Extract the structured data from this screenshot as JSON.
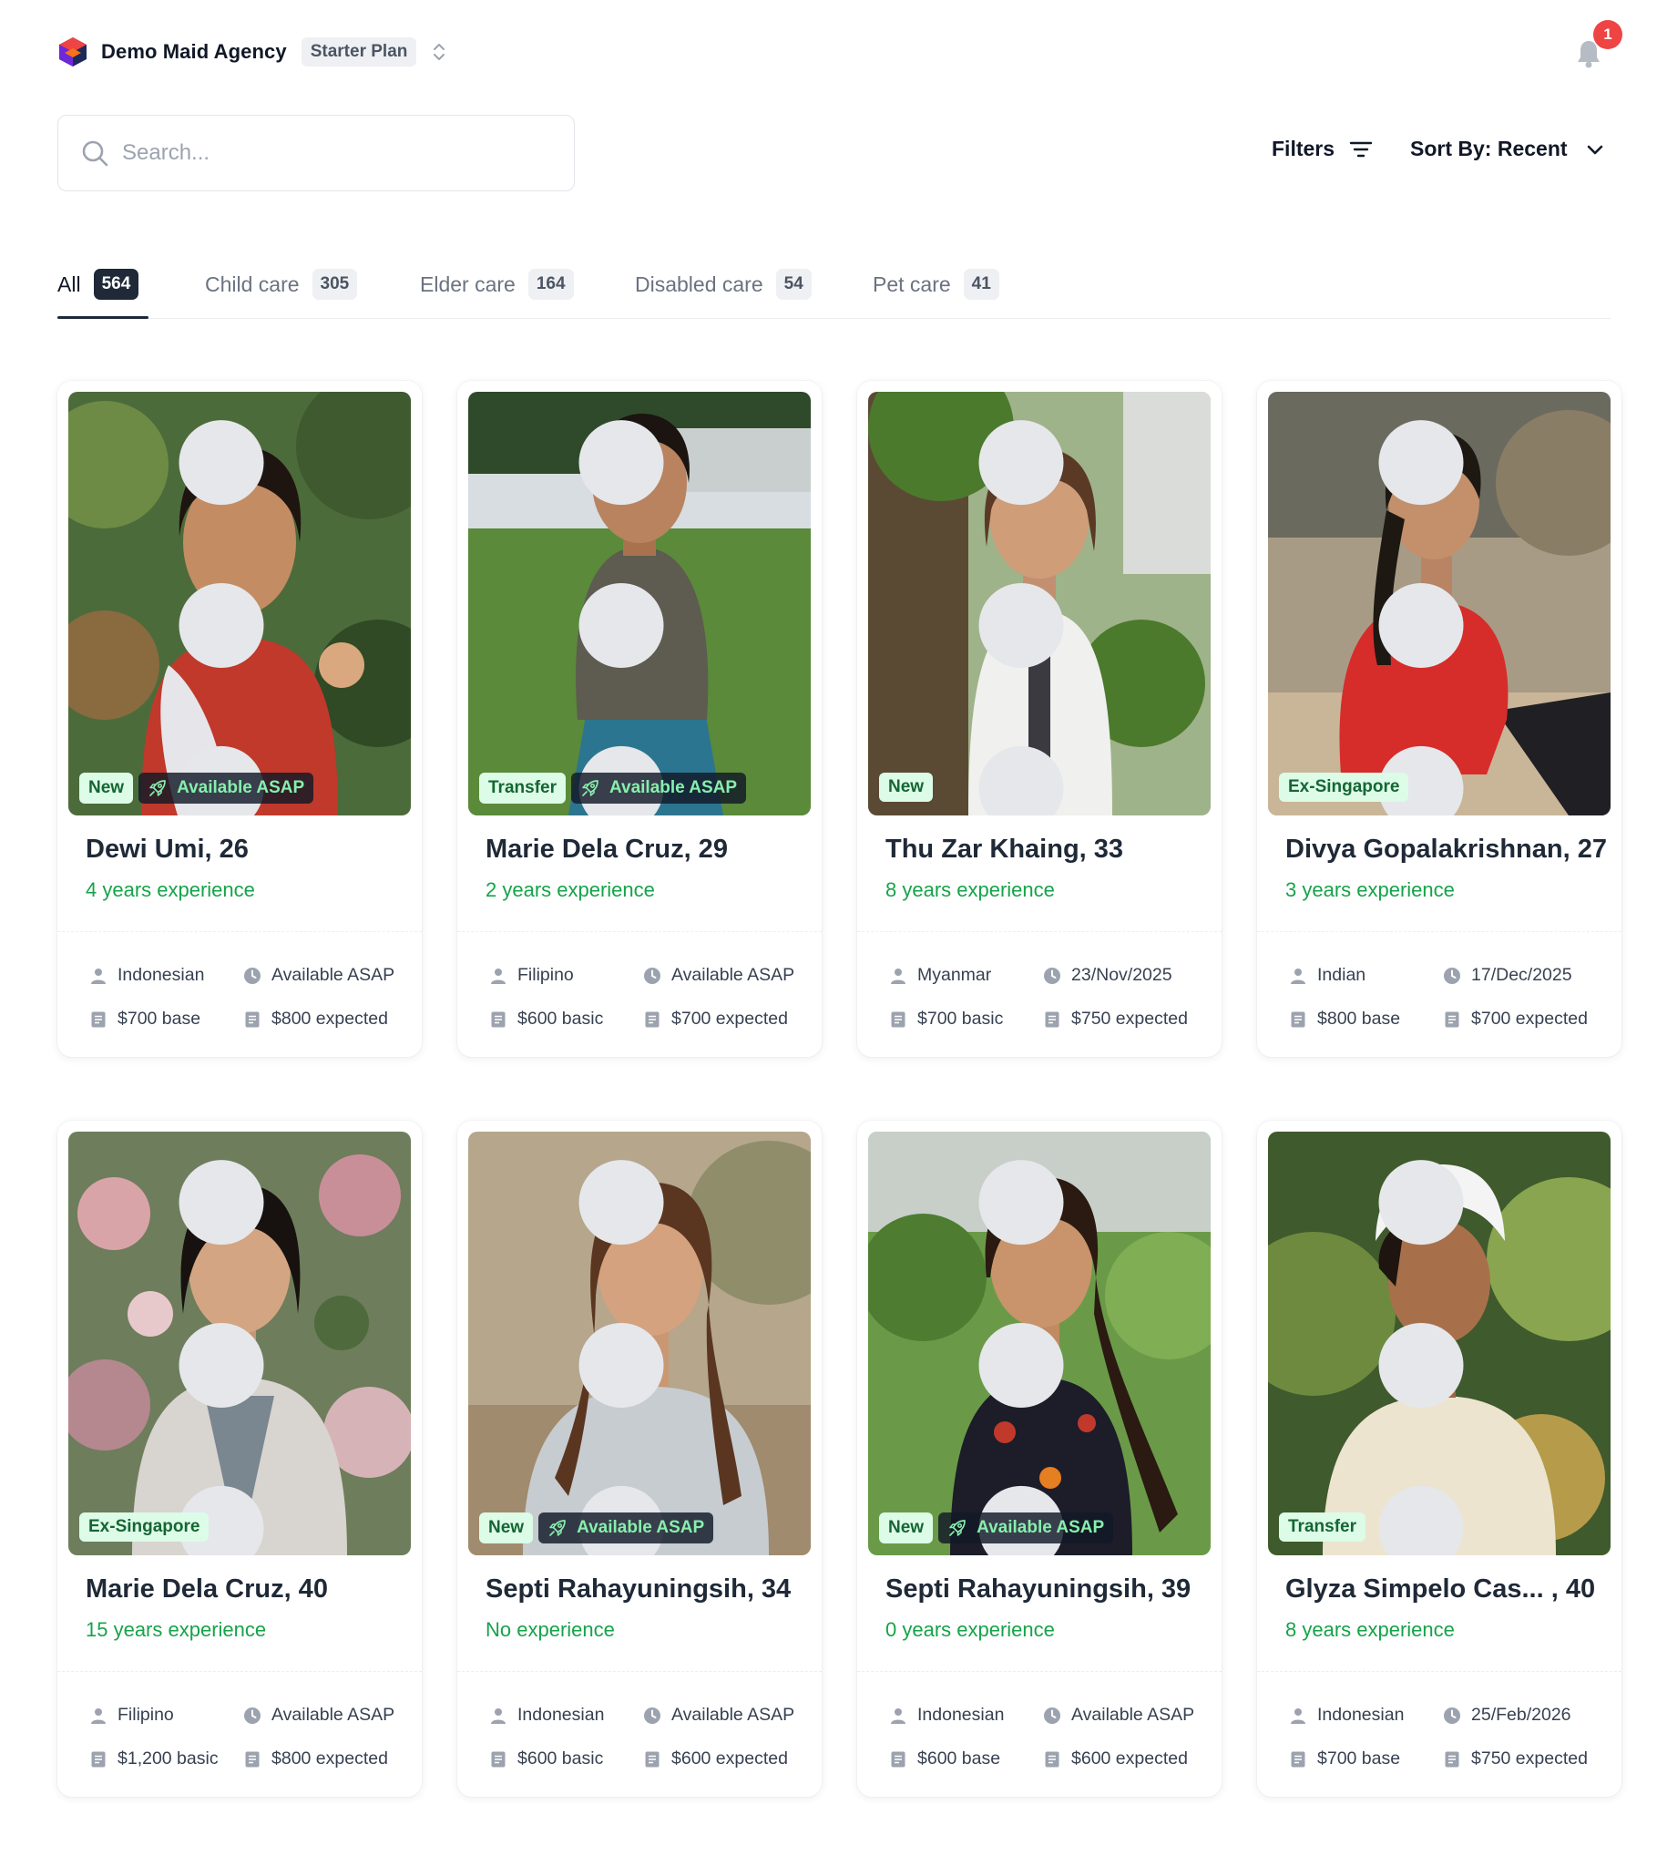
{
  "header": {
    "agency_name": "Demo Maid Agency",
    "plan_badge": "Starter Plan",
    "notification_count": "1"
  },
  "search": {
    "placeholder": "Search..."
  },
  "toolbar": {
    "filters_label": "Filters",
    "sort_label": "Sort By: Recent"
  },
  "tabs": [
    {
      "label": "All",
      "count": "564",
      "active": true
    },
    {
      "label": "Child care",
      "count": "305",
      "active": false
    },
    {
      "label": "Elder care",
      "count": "164",
      "active": false
    },
    {
      "label": "Disabled care",
      "count": "54",
      "active": false
    },
    {
      "label": "Pet care",
      "count": "41",
      "active": false
    }
  ],
  "icons": {
    "logo": "agency-logo-icon",
    "plan_switch": "chevron-up-down-icon",
    "notifications": "bell-icon",
    "search": "search-icon",
    "filters": "filter-lines-icon",
    "sort": "chevron-down-icon",
    "available_badge": "rocket-icon",
    "nationality": "person-icon",
    "availability": "clock-icon",
    "salary": "receipt-icon",
    "menu": "kebab-menu-icon"
  },
  "colors": {
    "accent_green": "#16a34a",
    "badge_light_bg": "#dcfce7",
    "badge_dark_text": "#86efac",
    "notification_red": "#ef4444",
    "primary_dark": "#1f2937"
  },
  "candidates": [
    {
      "name": "Dewi Umi, 26",
      "experience": "4 years experience",
      "badges": [
        "New"
      ],
      "available_badge": "Available ASAP",
      "nationality": "Indonesian",
      "availability": "Available ASAP",
      "salary": "$700 base",
      "expected": "$800 expected"
    },
    {
      "name": "Marie Dela Cruz, 29",
      "experience": "2 years experience",
      "badges": [
        "Transfer"
      ],
      "available_badge": "Available ASAP",
      "nationality": "Filipino",
      "availability": "Available ASAP",
      "salary": "$600 basic",
      "expected": "$700 expected"
    },
    {
      "name": "Thu Zar Khaing, 33",
      "experience": "8 years experience",
      "badges": [
        "New"
      ],
      "available_badge": "",
      "nationality": "Myanmar",
      "availability": "23/Nov/2025",
      "salary": "$700 basic",
      "expected": "$750 expected"
    },
    {
      "name": "Divya Gopalakrishnan, 27",
      "experience": "3 years experience",
      "badges": [
        "Ex-Singapore"
      ],
      "available_badge": "",
      "nationality": "Indian",
      "availability": "17/Dec/2025",
      "salary": "$800 base",
      "expected": "$700 expected"
    },
    {
      "name": "Marie Dela Cruz, 40",
      "experience": "15 years experience",
      "badges": [
        "Ex-Singapore"
      ],
      "available_badge": "",
      "nationality": "Filipino",
      "availability": "Available ASAP",
      "salary": "$1,200 basic",
      "expected": "$800 expected"
    },
    {
      "name": "Septi Rahayuningsih, 34",
      "experience": "No experience",
      "badges": [
        "New"
      ],
      "available_badge": "Available ASAP",
      "nationality": "Indonesian",
      "availability": "Available ASAP",
      "salary": "$600 basic",
      "expected": "$600 expected"
    },
    {
      "name": "Septi Rahayuningsih, 39",
      "experience": "0 years experience",
      "badges": [
        "New"
      ],
      "available_badge": "Available ASAP",
      "nationality": "Indonesian",
      "availability": "Available ASAP",
      "salary": "$600 base",
      "expected": "$600 expected"
    },
    {
      "name": "Glyza Simpelo Cas... , 40",
      "experience": "8 years experience",
      "badges": [
        "Transfer"
      ],
      "available_badge": "",
      "nationality": "Indonesian",
      "availability": "25/Feb/2026",
      "salary": "$700 base",
      "expected": "$750 expected"
    }
  ]
}
